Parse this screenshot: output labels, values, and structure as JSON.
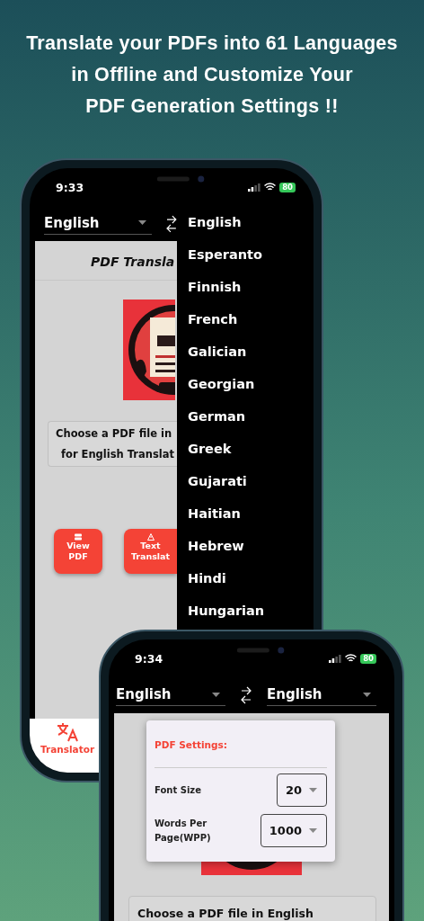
{
  "headline": "Translate your PDFs into 61 Languages\nin Offline and Customize Your\nPDF Generation Settings !!",
  "phone_1": {
    "status_bar": {
      "time": "9:33",
      "battery": "80"
    },
    "source_language": "English",
    "page_title": "PDF Transla",
    "file_prompt_lines": [
      "Choose a PDF file in",
      "for English Translat"
    ],
    "buttons": [
      {
        "label_lines": [
          "View",
          "PDF"
        ]
      },
      {
        "label_lines": [
          "Text",
          "Translat"
        ]
      }
    ],
    "language_menu": [
      "English",
      "Esperanto",
      "Finnish",
      "French",
      "Galician",
      "Georgian",
      "German",
      "Greek",
      "Gujarati",
      "Haitian",
      "Hebrew",
      "Hindi",
      "Hungarian"
    ],
    "tab_bar": [
      {
        "label": "Translator",
        "selected": true
      }
    ]
  },
  "phone_2": {
    "status_bar": {
      "time": "9:34",
      "battery": "80"
    },
    "source_language": "English",
    "target_language": "English",
    "settings_popup": {
      "title": "PDF Settings:",
      "rows": [
        {
          "label": "Font Size",
          "value": "20"
        },
        {
          "label": "Words Per Page(WPP)",
          "value": "1000"
        }
      ]
    },
    "file_prompt": "Choose a PDF file in English"
  }
}
